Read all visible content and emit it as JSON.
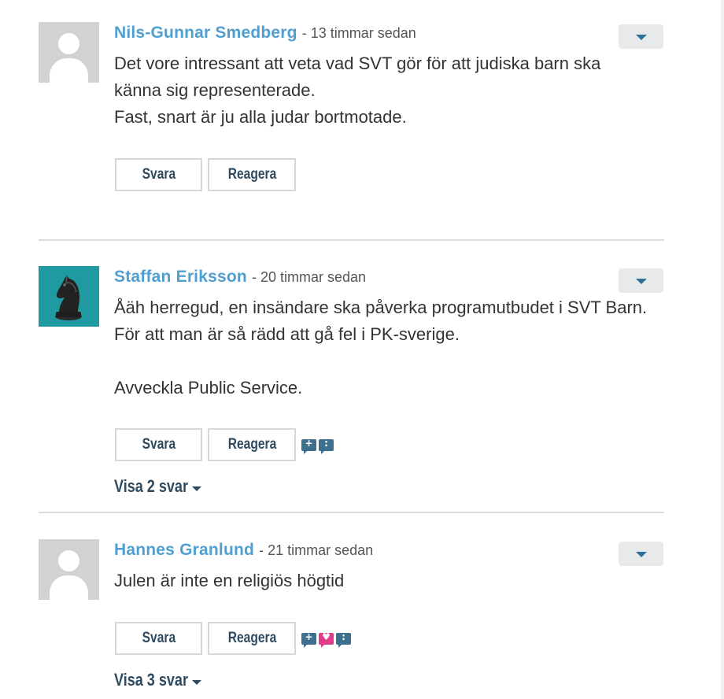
{
  "comments": [
    {
      "author": "Nils-Gunnar Smedberg",
      "time": "- 13 timmar sedan",
      "avatar": "default-user-icon",
      "lines": [
        "Det vore intressant att veta vad SVT gör för att  judiska barn ska känna sig representerade.",
        "Fast, snart är ju alla judar bortmotade."
      ],
      "reply_label": "Svara",
      "react_label": "Reagera"
    },
    {
      "author": "Staffan Eriksson",
      "time": "- 20 timmar sedan",
      "avatar": "chess-knight-avatar",
      "lines": [
        "Åäh herregud, en insändare ska påverka programutbudet i SVT Barn. För att man är så rädd att gå fel i PK-sverige.",
        "Avveckla Public Service."
      ],
      "reply_label": "Svara",
      "react_label": "Reagera",
      "reactions": [
        "thumbs-up-reaction-icon",
        "thinking-reaction-icon"
      ],
      "show_replies": "Visa 2 svar"
    },
    {
      "author": "Hannes Granlund",
      "time": "- 21 timmar sedan",
      "avatar": "default-user-icon",
      "lines": [
        "Julen är inte en religiös högtid"
      ],
      "reply_label": "Svara",
      "react_label": "Reagera",
      "reactions": [
        "thumbs-up-reaction-icon",
        "heart-reaction-icon",
        "thinking-reaction-icon"
      ],
      "show_replies": "Visa 3 svar"
    }
  ],
  "colors": {
    "author": "#4f9fd0",
    "button_text": "#2f4a5e",
    "reaction_blue": "#3d6f8e",
    "reaction_pink": "#e03c8a",
    "avatar_teal": "#1f9aa0"
  }
}
